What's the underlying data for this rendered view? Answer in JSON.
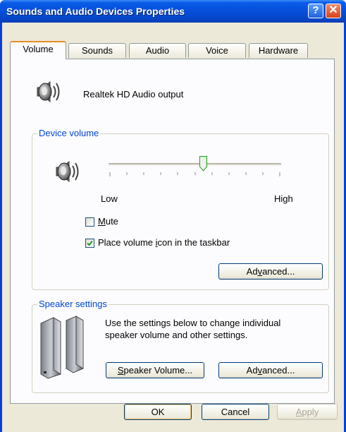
{
  "window": {
    "title": "Sounds and Audio Devices Properties",
    "help_glyph": "?",
    "close_glyph": "✕"
  },
  "tabs": [
    {
      "label": "Volume",
      "active": true
    },
    {
      "label": "Sounds"
    },
    {
      "label": "Audio"
    },
    {
      "label": "Voice"
    },
    {
      "label": "Hardware"
    }
  ],
  "device": {
    "name": "Realtek HD Audio output",
    "icon": "speaker-icon"
  },
  "device_volume": {
    "legend": "Device volume",
    "low_label": "Low",
    "high_label": "High",
    "level_fraction": 0.55,
    "mute": {
      "label_pre": "",
      "label_ul": "M",
      "label_post": "ute",
      "checked": false
    },
    "taskbar": {
      "label_pre": "Place volume ",
      "label_ul": "i",
      "label_post": "con in the taskbar",
      "checked": true
    },
    "advanced": {
      "label_pre": "Ad",
      "label_ul": "v",
      "label_post": "anced..."
    }
  },
  "speaker_settings": {
    "legend": "Speaker settings",
    "description_line1": "Use the settings below to change individual",
    "description_line2": "speaker volume and other settings.",
    "speaker_volume": {
      "label_pre": "",
      "label_ul": "S",
      "label_post": "peaker Volume..."
    },
    "advanced": {
      "label_pre": "Ad",
      "label_ul": "v",
      "label_post": "anced..."
    }
  },
  "buttons": {
    "ok": "OK",
    "cancel": "Cancel",
    "apply": {
      "label_pre": "",
      "label_ul": "A",
      "label_post": "pply"
    }
  }
}
